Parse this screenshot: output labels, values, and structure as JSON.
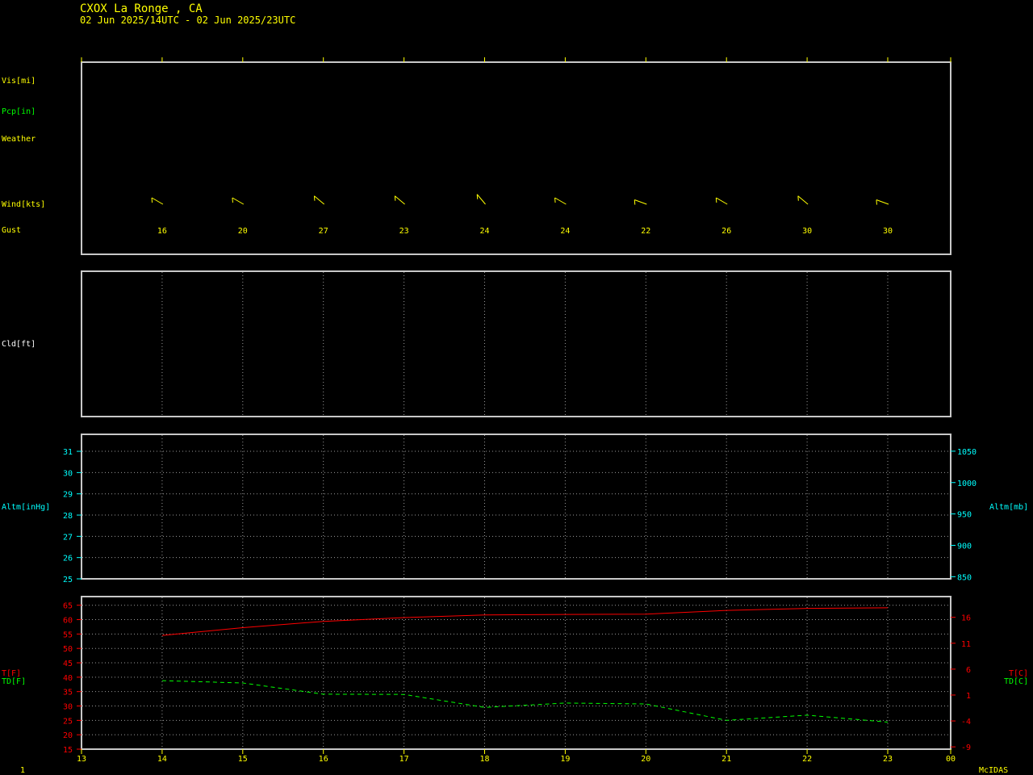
{
  "header": {
    "station": "CXOX  La Ronge ,  CA",
    "period": "02 Jun 2025/14UTC - 02 Jun 2025/23UTC"
  },
  "colors": {
    "frame": "#c8c8c8",
    "yellow": "#ffff00",
    "green": "#00ff00",
    "cyan": "#00ffff",
    "red": "#ff0000",
    "white": "#ffffff"
  },
  "labels": {
    "vis": "Vis[mi]",
    "pcp": "Pcp[in]",
    "weather": "Weather",
    "wind": "Wind[kts]",
    "gust": "Gust",
    "cld": "Cld[ft]",
    "altm_left": "Altm[inHg]",
    "altm_right": "Altm[mb]",
    "t_left": "T[F]",
    "td_left": "TD[F]",
    "t_right": "T[C]",
    "td_right": "TD[C]"
  },
  "footer": {
    "page_number": "1",
    "brand": "McIDAS"
  },
  "chart_data": {
    "type": "line",
    "x_tick_labels": [
      "13",
      "14",
      "15",
      "16",
      "17",
      "18",
      "19",
      "20",
      "21",
      "22",
      "23",
      "00"
    ],
    "hours": [
      14,
      15,
      16,
      17,
      18,
      19,
      20,
      21,
      22,
      23
    ],
    "wind": {
      "gust_kts": [
        16,
        20,
        27,
        23,
        24,
        24,
        22,
        26,
        30,
        30
      ],
      "direction_deg": [
        300,
        300,
        310,
        310,
        320,
        300,
        290,
        300,
        310,
        290
      ]
    },
    "altimeter": {
      "ticks_inhg": [
        "25",
        "26",
        "27",
        "28",
        "29",
        "30",
        "31"
      ],
      "ticks_mb": [
        "850",
        "900",
        "950",
        "1000",
        "1050"
      ],
      "ylim_inhg": [
        25,
        31.8
      ]
    },
    "temperature": {
      "ticks_f": [
        "15",
        "20",
        "25",
        "30",
        "35",
        "40",
        "45",
        "50",
        "55",
        "60",
        "65"
      ],
      "ticks_c": [
        "-9",
        "-4",
        "1",
        "6",
        "11",
        "16"
      ],
      "ylim_f": [
        15,
        68
      ],
      "series": [
        {
          "values": [
            54.5,
            57.2,
            59.4,
            60.7,
            61.6,
            61.8,
            61.9,
            63.2,
            63.9,
            64.1
          ]
        },
        {
          "values": [
            38.8,
            38.0,
            34.1,
            34.0,
            29.5,
            31.0,
            30.7,
            25.0,
            26.8,
            24.4
          ]
        }
      ]
    }
  }
}
